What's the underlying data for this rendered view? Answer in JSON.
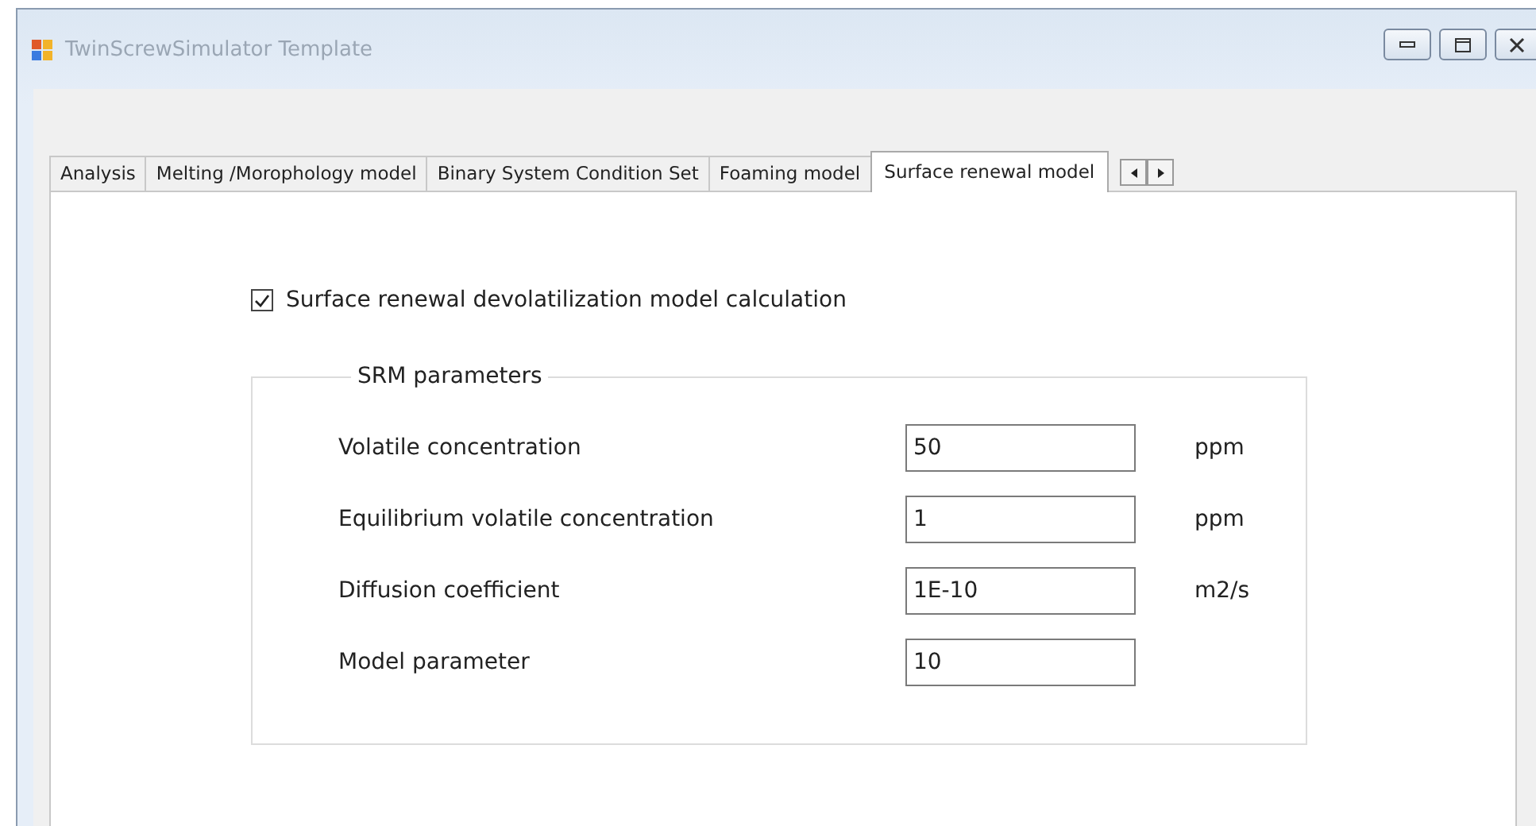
{
  "window": {
    "title": "TwinScrewSimulator Template"
  },
  "tabs": [
    {
      "label": "Analysis",
      "selected": false
    },
    {
      "label": "Melting /Morophology model",
      "selected": false
    },
    {
      "label": "Binary System Condition Set",
      "selected": false
    },
    {
      "label": "Foaming model",
      "selected": false
    },
    {
      "label": "Surface renewal model",
      "selected": true
    }
  ],
  "calculation_checkbox": {
    "label": "Surface renewal devolatilization model calculation",
    "checked": true
  },
  "group": {
    "title": "SRM parameters",
    "rows": [
      {
        "label": "Volatile concentration",
        "value": "50",
        "unit": "ppm"
      },
      {
        "label": "Equilibrium volatile concentration",
        "value": "1",
        "unit": "ppm"
      },
      {
        "label": "Diffusion coefficient",
        "value": "1E-10",
        "unit": "m2/s"
      },
      {
        "label": "Model parameter",
        "value": "10"
      }
    ]
  }
}
